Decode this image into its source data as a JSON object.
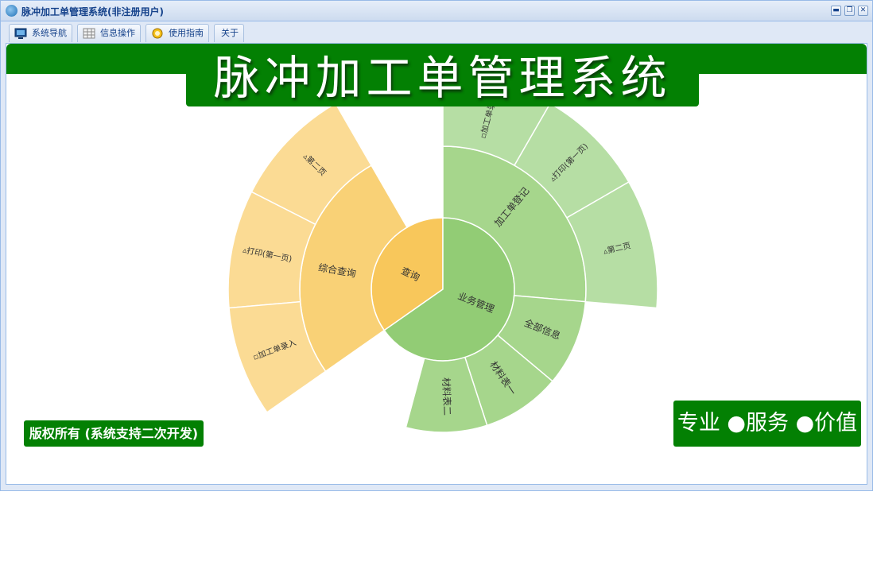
{
  "window": {
    "title": "脉冲加工单管理系统(非注册用户)",
    "min_glyph": "▬",
    "max_glyph": "❐",
    "close_glyph": "✕"
  },
  "tabs": [
    {
      "label": "系统导航"
    },
    {
      "label": "信息操作"
    },
    {
      "label": "使用指南"
    },
    {
      "label": "关于"
    }
  ],
  "banner": {
    "title": "脉冲加工单管理系统"
  },
  "copyright": "版权所有 (系统支持二次开发)",
  "slogan": "专业 ●服务 ●价值",
  "sunburst": {
    "colors": {
      "orange_inner": "#f8c75b",
      "orange_mid": "#f9d176",
      "orange_outer": "#fbdb94",
      "green_inner": "#92cc75",
      "green_mid": "#a6d68c",
      "green_outer": "#b6dea4",
      "stroke": "#ffffff"
    },
    "inner": [
      "查询",
      "业务管理"
    ],
    "middle": [
      "综合查询",
      "加工单登记",
      "全部信息",
      "材料表一",
      "材料表二"
    ],
    "outer_query": [
      "▵第二页",
      "▵打印(第一页)",
      "▫加工单录入"
    ],
    "outer_business": [
      "▫加工单录入",
      "▵打印(第一页)",
      "▵第二页"
    ]
  }
}
